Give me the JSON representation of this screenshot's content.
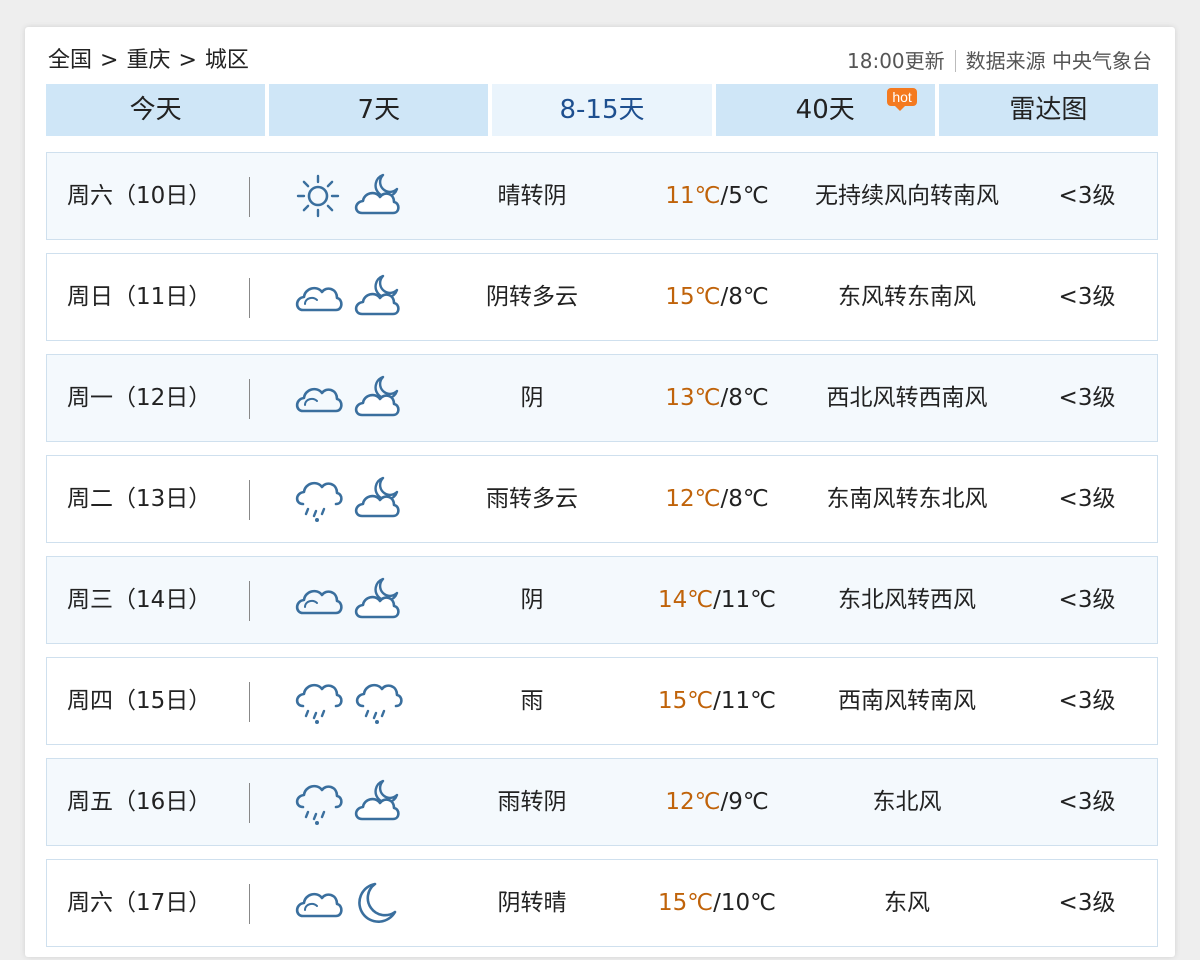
{
  "breadcrumb": [
    "全国",
    "重庆",
    "城区"
  ],
  "breadcrumb_sep": ">",
  "meta": {
    "updated": "18:00更新",
    "source": "数据来源 中央气象台"
  },
  "tabs": [
    {
      "label": "今天"
    },
    {
      "label": "7天"
    },
    {
      "label": "8-15天"
    },
    {
      "label": "40天",
      "badge": "hot"
    },
    {
      "label": "雷达图"
    }
  ],
  "colors": {
    "tab_bg": "#cfe6f7",
    "tab_active": "#eaf4fc",
    "high_temp": "#c0630a",
    "hot_badge": "#f47a20",
    "icon": "#3a6f9e"
  },
  "forecast": [
    {
      "date": "周六（10日）",
      "icon_day": "sun-icon",
      "icon_night": "cloud-moon-icon",
      "desc": "晴转阴",
      "high": "11℃",
      "low": "5℃",
      "wind": "无持续风向转南风",
      "level": "<3级"
    },
    {
      "date": "周日（11日）",
      "icon_day": "cloud-icon",
      "icon_night": "cloud-moon-icon",
      "desc": "阴转多云",
      "high": "15℃",
      "low": "8℃",
      "wind": "东风转东南风",
      "level": "<3级"
    },
    {
      "date": "周一（12日）",
      "icon_day": "cloud-icon",
      "icon_night": "cloud-moon-icon",
      "desc": "阴",
      "high": "13℃",
      "low": "8℃",
      "wind": "西北风转西南风",
      "level": "<3级"
    },
    {
      "date": "周二（13日）",
      "icon_day": "rain-icon",
      "icon_night": "cloud-moon-icon",
      "desc": "雨转多云",
      "high": "12℃",
      "low": "8℃",
      "wind": "东南风转东北风",
      "level": "<3级"
    },
    {
      "date": "周三（14日）",
      "icon_day": "cloud-icon",
      "icon_night": "cloud-moon-icon",
      "desc": "阴",
      "high": "14℃",
      "low": "11℃",
      "wind": "东北风转西风",
      "level": "<3级"
    },
    {
      "date": "周四（15日）",
      "icon_day": "rain-icon",
      "icon_night": "rain-icon",
      "desc": "雨",
      "high": "15℃",
      "low": "11℃",
      "wind": "西南风转南风",
      "level": "<3级"
    },
    {
      "date": "周五（16日）",
      "icon_day": "rain-icon",
      "icon_night": "cloud-moon-icon",
      "desc": "雨转阴",
      "high": "12℃",
      "low": "9℃",
      "wind": "东北风",
      "level": "<3级"
    },
    {
      "date": "周六（17日）",
      "icon_day": "cloud-icon",
      "icon_night": "moon-icon",
      "desc": "阴转晴",
      "high": "15℃",
      "low": "10℃",
      "wind": "东风",
      "level": "<3级"
    }
  ]
}
